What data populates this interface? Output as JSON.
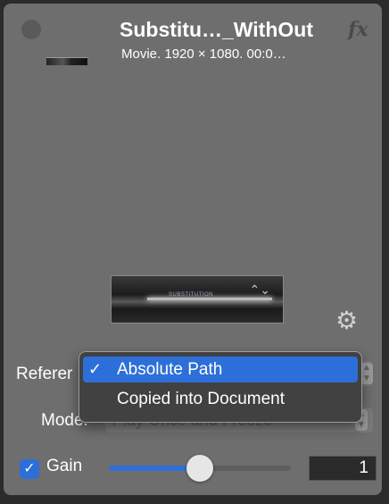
{
  "header": {
    "title": "Substitu…_WithOut",
    "fx_label": "fx",
    "subtitle": "Movie. 1920 × 1080. 00:0…"
  },
  "preview": {
    "label": "SUBSTITUTION",
    "arrows": "⌃⌄"
  },
  "reference": {
    "label": "Referer",
    "menu_items": [
      {
        "label": "Absolute Path",
        "selected": true,
        "check": "✓"
      },
      {
        "label": "Copied into Document",
        "selected": false,
        "check": ""
      }
    ]
  },
  "mode": {
    "label": "Mode:",
    "value": "Play Once and Freeze"
  },
  "gain": {
    "label": "Gain",
    "checked": true,
    "check_glyph": "✓",
    "value": "1",
    "slider_fraction": 0.5
  },
  "colors": {
    "accent": "#2d6fd9",
    "panel_bg": "#6e6e6e",
    "menu_bg": "#414141"
  }
}
